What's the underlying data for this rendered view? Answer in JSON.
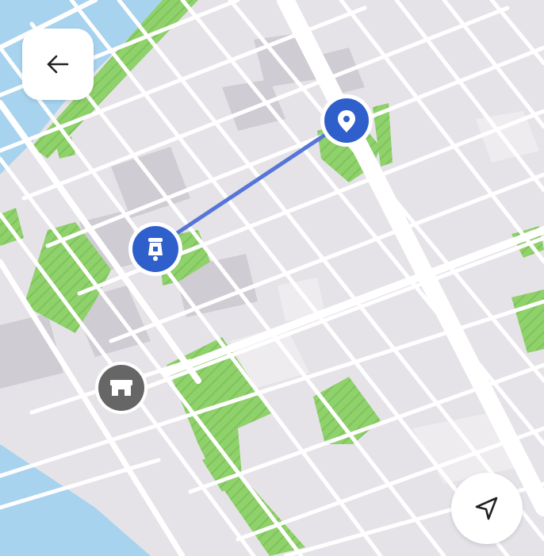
{
  "map": {
    "colors": {
      "land": "#e6e3e8",
      "block": "#dedbe2",
      "road": "#ffffff",
      "park": "#8fd16b",
      "park_stripe": "#7fc35c",
      "water": "#a7d3ef",
      "building": "#c9c6cd",
      "route": "#5576d8",
      "marker_blue": "#2f5fcb",
      "marker_gray": "#666666"
    },
    "markers": [
      {
        "name": "destination-pin-marker",
        "icon": "location-pin-icon"
      },
      {
        "name": "scooter-marker",
        "icon": "scooter-icon"
      },
      {
        "name": "store-marker",
        "icon": "storefront-icon"
      }
    ]
  },
  "controls": {
    "back_button": {
      "icon": "arrow-left-icon"
    },
    "locate_button": {
      "icon": "navigation-arrow-icon"
    }
  }
}
